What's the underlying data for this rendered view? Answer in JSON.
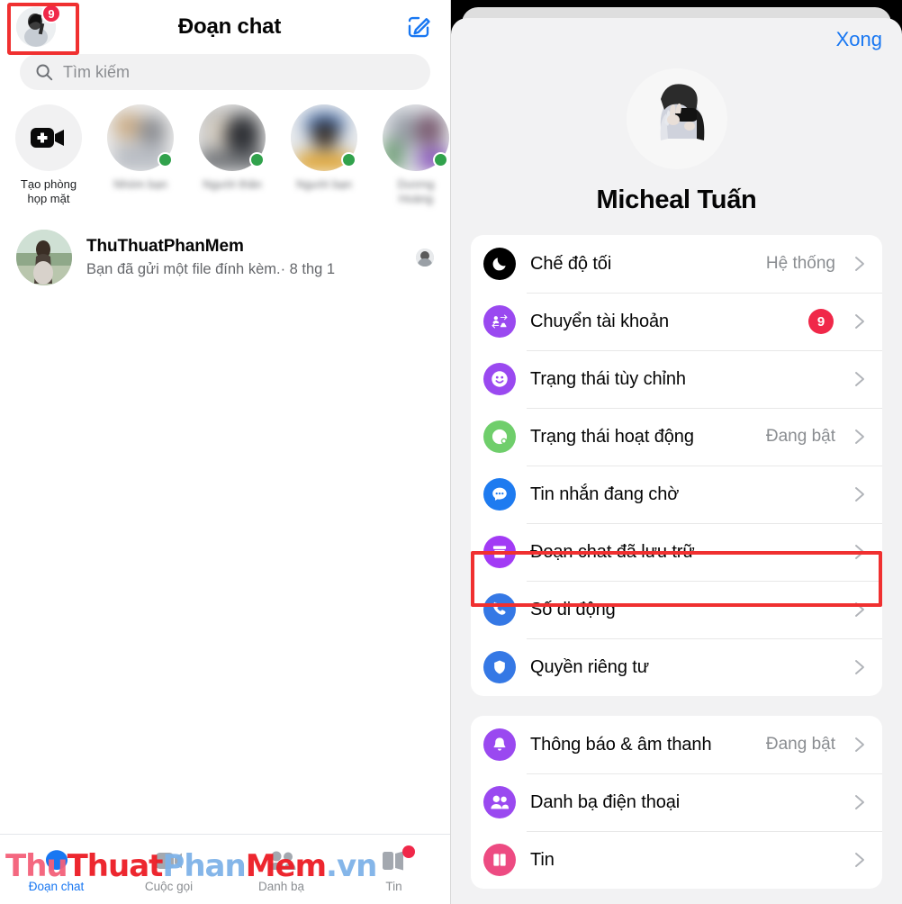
{
  "left": {
    "header": {
      "title": "Đoạn chat",
      "avatar_badge": "9",
      "avatar_icon": "user-avatar",
      "compose_icon": "compose-pencil-icon"
    },
    "search": {
      "placeholder": "Tìm kiếm",
      "icon": "search-icon"
    },
    "stories": [
      {
        "label": "Tạo phòng họp mặt",
        "icon": "video-plus-icon",
        "type": "create-room",
        "online": false,
        "blurred": false
      },
      {
        "label": "Nhóm bạn",
        "type": "story",
        "online": true,
        "blurred": true
      },
      {
        "label": "Người thân",
        "type": "story",
        "online": true,
        "blurred": true
      },
      {
        "label": "Người bạn",
        "type": "story",
        "online": true,
        "blurred": true
      },
      {
        "label": "Dương Hoàng",
        "type": "story",
        "online": true,
        "blurred": true
      }
    ],
    "chats": [
      {
        "name": "ThuThuatPhanMem",
        "snippet": "Bạn đã gửi một file đính kèm.· 8 thg 1",
        "seen_avatar": "seen-receipt-avatar"
      }
    ],
    "bottom_nav": [
      {
        "label": "Đoạn chat",
        "icon": "chat-bubble-icon",
        "active": true,
        "dot": false
      },
      {
        "label": "Cuộc gọi",
        "icon": "video-camera-icon",
        "active": false,
        "dot": false
      },
      {
        "label": "Danh bạ",
        "icon": "people-icon",
        "active": false,
        "dot": false
      },
      {
        "label": "Tin",
        "icon": "stories-icon",
        "active": false,
        "dot": true
      }
    ],
    "watermark": {
      "part1": "Thu",
      "part2": "Thuat",
      "part3": "Phan",
      "part4": "Mem",
      "part5": ".vn"
    }
  },
  "right": {
    "done_label": "Xong",
    "profile": {
      "name": "Micheal Tuấn",
      "avatar_icon": "profile-avatar"
    },
    "groups": [
      {
        "rows": [
          {
            "label": "Chế độ tối",
            "value": "Hệ thống",
            "badge": "",
            "icon": "moon-icon",
            "icon_color": "#000000"
          },
          {
            "label": "Chuyển tài khoản",
            "value": "",
            "badge": "9",
            "icon": "switch-account-icon",
            "icon_color": "#9a49f0"
          },
          {
            "label": "Trạng thái tùy chỉnh",
            "value": "",
            "badge": "",
            "icon": "smiley-icon",
            "icon_color": "#9a49f0"
          },
          {
            "label": "Trạng thái hoạt động",
            "value": "Đang bật",
            "badge": "",
            "icon": "active-status-icon",
            "icon_color": "#6fce6b"
          },
          {
            "label": "Tin nhắn đang chờ",
            "value": "",
            "badge": "",
            "icon": "message-dots-icon",
            "icon_color": "#1e7bf0"
          },
          {
            "label": "Đoạn chat đã lưu trữ",
            "value": "",
            "badge": "",
            "icon": "archive-box-icon",
            "icon_color": "#a23bf5"
          },
          {
            "label": "Số di động",
            "value": "",
            "badge": "",
            "icon": "phone-icon",
            "icon_color": "#3578e5"
          },
          {
            "label": "Quyền riêng tư",
            "value": "",
            "badge": "",
            "icon": "shield-icon",
            "icon_color": "#3578e5"
          }
        ]
      },
      {
        "rows": [
          {
            "label": "Thông báo & âm thanh",
            "value": "Đang bật",
            "badge": "",
            "icon": "bell-icon",
            "icon_color": "#9a49f0"
          },
          {
            "label": "Danh bạ điện thoại",
            "value": "",
            "badge": "",
            "icon": "people-icon",
            "icon_color": "#9a49f0"
          },
          {
            "label": "Tin",
            "value": "",
            "badge": "",
            "icon": "stories-book-icon",
            "icon_color": "#ed4b82"
          }
        ]
      }
    ],
    "highlight": {
      "target_row_label": "Đoạn chat đã lưu trữ",
      "color": "#f03030"
    }
  },
  "colors": {
    "accent_blue": "#1877f2",
    "badge_red": "#f02849",
    "online_green": "#31a24c",
    "highlight_red": "#f03030"
  }
}
